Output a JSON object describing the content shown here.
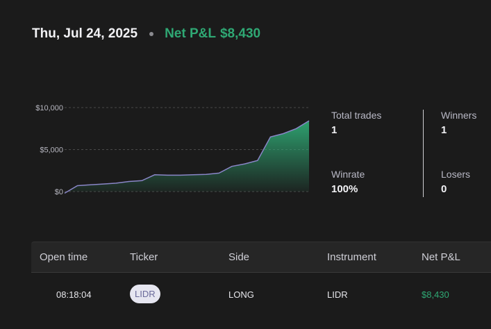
{
  "header": {
    "date": "Thu, Jul 24, 2025",
    "pnl_label": "Net P&L",
    "pnl_value": "$8,430"
  },
  "colors": {
    "background": "#1b1b1b",
    "profit_green": "#2fa874",
    "line": "#8a86c8"
  },
  "chart_data": {
    "type": "area",
    "title": "",
    "xlabel": "",
    "ylabel": "",
    "ylim": [
      0,
      10000
    ],
    "y_ticks": [
      0,
      5000,
      10000
    ],
    "y_tick_labels": [
      "$0",
      "$5,000",
      "$10,000"
    ],
    "grid": true,
    "series": [
      {
        "values": [
          -200,
          700,
          800,
          900,
          1000,
          1200,
          1300,
          2000,
          1950,
          1950,
          2000,
          2050,
          2200,
          3000,
          3300,
          3700,
          6500,
          6900,
          7500,
          8430
        ]
      }
    ]
  },
  "stats": {
    "total_trades_label": "Total trades",
    "total_trades_value": "1",
    "winners_label": "Winners",
    "winners_value": "1",
    "winrate_label": "Winrate",
    "winrate_value": "100%",
    "losers_label": "Losers",
    "losers_value": "0"
  },
  "table": {
    "columns": [
      "Open time",
      "Ticker",
      "Side",
      "Instrument",
      "Net P&L"
    ],
    "rows": [
      {
        "open_time": "08:18:04",
        "ticker": "LIDR",
        "side": "LONG",
        "instrument": "LIDR",
        "net_pnl": "$8,430"
      }
    ]
  }
}
